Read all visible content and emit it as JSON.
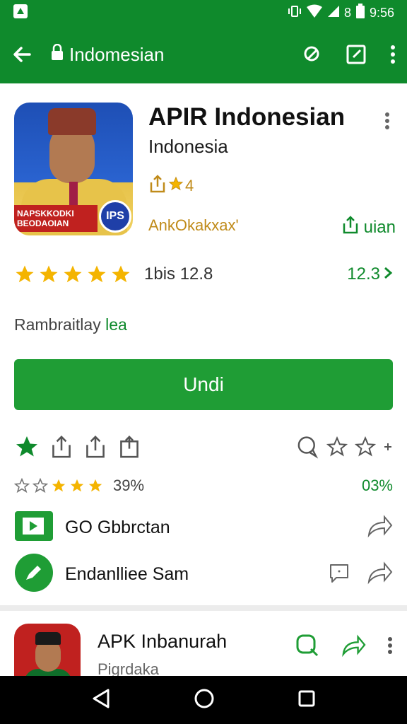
{
  "status_bar": {
    "time": "9:56",
    "icons": [
      "app-notification-icon",
      "vibrate-icon",
      "wifi-icon",
      "signal-icon",
      "battery-icon"
    ],
    "carrier_glyph": "8"
  },
  "app_bar": {
    "title": "Indomesian",
    "background": "#0f8a2c"
  },
  "app": {
    "name": "APIR Indonesian",
    "subtitle": "Indonesia",
    "meta_value": "4",
    "developer": "AnkOkakxax'",
    "install_label": "uian",
    "icon": {
      "banner_line1": "NAPSKKODKI",
      "banner_line2": "BEODAOIAN",
      "badge": "IPS"
    }
  },
  "rating": {
    "stars_filled": 5,
    "text": "1bis 12.8",
    "right_value": "12.3"
  },
  "category": {
    "text": "Rambraitlay",
    "accent": "lea"
  },
  "main_button": {
    "label": "Undi"
  },
  "mini_rating": {
    "percent_left": "39%",
    "percent_right": "03%"
  },
  "rows": [
    {
      "label": "GO Gbbrctan"
    },
    {
      "label": "Endanlliee Sam"
    }
  ],
  "card": {
    "title": "APK Inbanurah",
    "subtitle": "Pigrdaka"
  },
  "colors": {
    "green": "#0f8a2c",
    "button_green": "#1f9d35",
    "star_gold": "#f4b400",
    "meta_gold": "#c08b1a"
  }
}
